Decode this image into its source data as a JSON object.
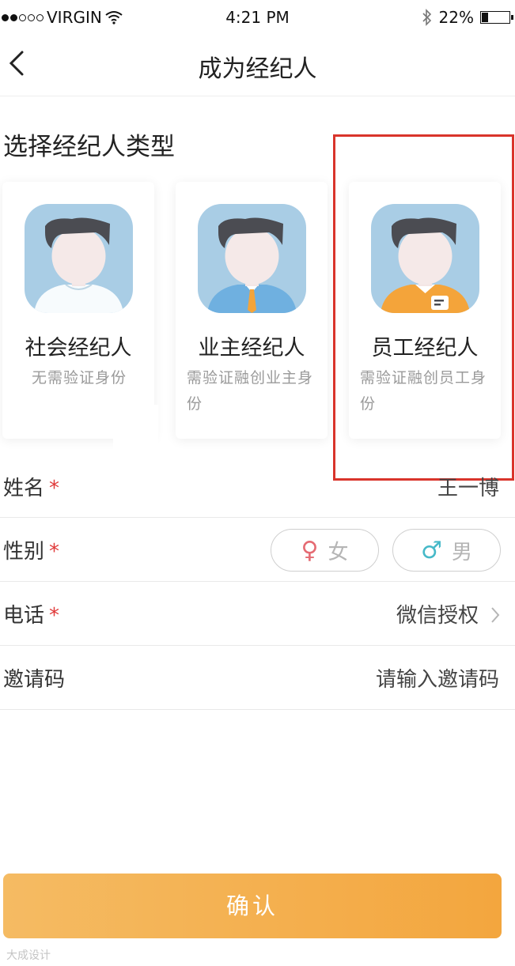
{
  "status_bar": {
    "carrier": "VIRGIN",
    "time": "4:21 PM",
    "battery": "22%",
    "signal_bars": 2,
    "signal_total": 5,
    "battery_level": 0.22,
    "icons": [
      "signal-dots-icon",
      "wifi-icon",
      "bluetooth-icon",
      "battery-icon"
    ]
  },
  "nav": {
    "title": "成为经纪人",
    "back_icon": "chevron-left-icon"
  },
  "section_title": "选择经纪人类型",
  "agent_types": [
    {
      "title": "社会经纪人",
      "desc": "无需验证身份"
    },
    {
      "title": "业主经纪人",
      "desc": "需验证融创业主身份"
    },
    {
      "title": "员工经纪人",
      "desc": "需验证融创员工身份"
    }
  ],
  "form": {
    "name_label": "姓名",
    "name_value": "王一博",
    "gender_label": "性别",
    "gender_female": "女",
    "gender_male": "男",
    "phone_label": "电话",
    "phone_value": "微信授权",
    "invite_label": "邀请码",
    "invite_placeholder": "请输入邀请码",
    "required_mark": "*"
  },
  "confirm_label": "确认",
  "watermark": "大成设计",
  "colors": {
    "required": "#e03a3a",
    "button_start": "#f5bb63",
    "button_end": "#f3a63e",
    "highlight": "#d9342b",
    "female": "#e56b73",
    "male": "#46b9c8",
    "avatar_bg": "#a9cde5"
  }
}
